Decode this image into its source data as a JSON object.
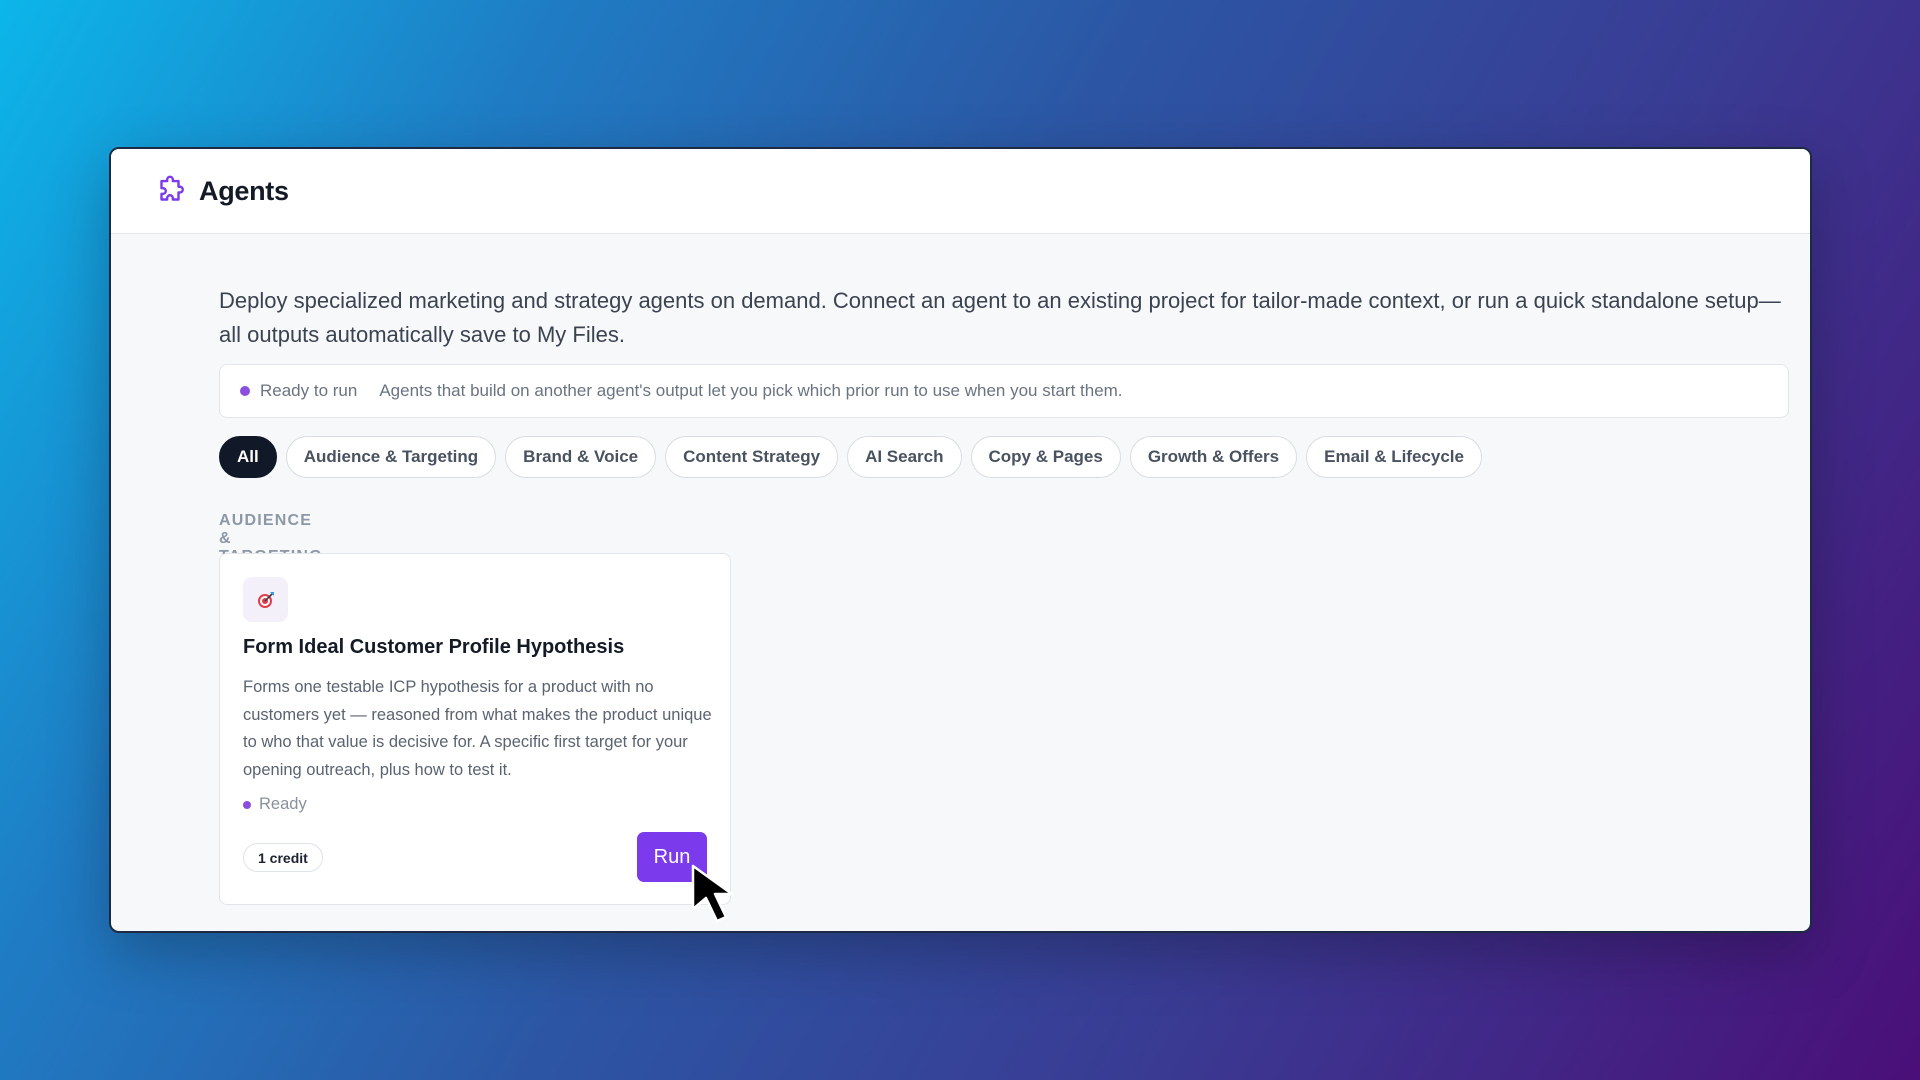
{
  "app": {
    "title": "Agents",
    "logo_icon": "puzzle-icon",
    "accent_color": "#7c3aed"
  },
  "intro_text": "Deploy specialized marketing and strategy agents on demand. Connect an agent to an existing project for tailor-made context, or run a quick standalone setup—all outputs automatically save to My Files.",
  "notice": {
    "status": "Ready to run",
    "message": "Agents that build on another agent's output let you pick which prior run to use when you start them."
  },
  "filters": {
    "selected": "All",
    "items": [
      "All",
      "Audience & Targeting",
      "Brand & Voice",
      "Content Strategy",
      "AI Search",
      "Copy & Pages",
      "Growth & Offers",
      "Email & Lifecycle"
    ]
  },
  "section": {
    "label": "AUDIENCE & TARGETING",
    "cards": [
      {
        "icon": "target-icon",
        "title": "Form Ideal Customer Profile Hypothesis",
        "description": "Forms one testable ICP hypothesis for a product with no customers yet — reasoned from what makes the product unique to who that value is decisive for. A specific first target for your opening outreach, plus how to test it.",
        "status": "Ready",
        "credit": "1 credit",
        "action": "Run"
      }
    ]
  }
}
